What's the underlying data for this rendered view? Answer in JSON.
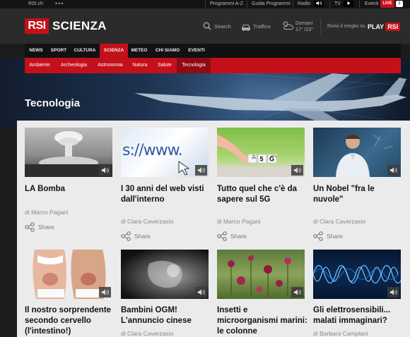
{
  "topbar": {
    "site": "RSI.ch",
    "more": "•••",
    "links": [
      "Programmi A-Z",
      "Guida Programmi",
      "Radio",
      "TV",
      "Eventi"
    ],
    "live": "LIVE",
    "live_count": "1"
  },
  "header": {
    "logo": "RSI",
    "section": "SCIENZA",
    "search": "Search",
    "traffic": "Traffico",
    "weather_day": "Domani",
    "weather_temp": "17° /23°",
    "play_prompt": "Rivivi il meglio su",
    "play_brand": "PLAY",
    "play_rsi": "RSI"
  },
  "main_nav": {
    "items": [
      "NEWS",
      "SPORT",
      "CULTURA",
      "SCIENZA",
      "METEO",
      "CHI SIAMO",
      "EVENTI"
    ],
    "active": "SCIENZA"
  },
  "sub_nav": {
    "items": [
      "Ambiente",
      "Archeologia",
      "Astronomia",
      "Natura",
      "Salute",
      "Tecnologia"
    ],
    "active": "Tecnologia"
  },
  "page_title": "Tecnologia",
  "share_label": "Share",
  "cards": [
    {
      "title": "LA Bomba",
      "author": "di Marco Pagani"
    },
    {
      "title": "I 30 anni del web visti dall'interno",
      "author": "di Clara Caverzasio"
    },
    {
      "title": "Tutto quel che c'è da sapere sul 5G",
      "author": "di Marco Pagani"
    },
    {
      "title": "Un Nobel \"fra le nuvole\"",
      "author": "di Clara Caverzasio"
    },
    {
      "title": "Il nostro sorprendente secondo cervello (l'intestino!)",
      "author": ""
    },
    {
      "title": "Bambini OGM! L'annuncio cinese",
      "author": "di Clara Caverzasio"
    },
    {
      "title": "Insetti e microorganismi marini: le colonne",
      "author": ""
    },
    {
      "title": "Gli elettrosensibili... malati immaginari?",
      "author": "di Barbara Camplani"
    }
  ],
  "thumb_text": {
    "web_url": "s://www.",
    "cube_5": "5",
    "cube_g": "G"
  },
  "colors": {
    "accent_red": "#c4101a",
    "active_sub": "#8e0c12",
    "header_bg": "#2b2b2b",
    "content_bg": "#ebebeb"
  },
  "icons": [
    "search-icon",
    "car-icon",
    "cloud-sun-icon",
    "speaker-icon",
    "play-icon",
    "share-icon"
  ]
}
